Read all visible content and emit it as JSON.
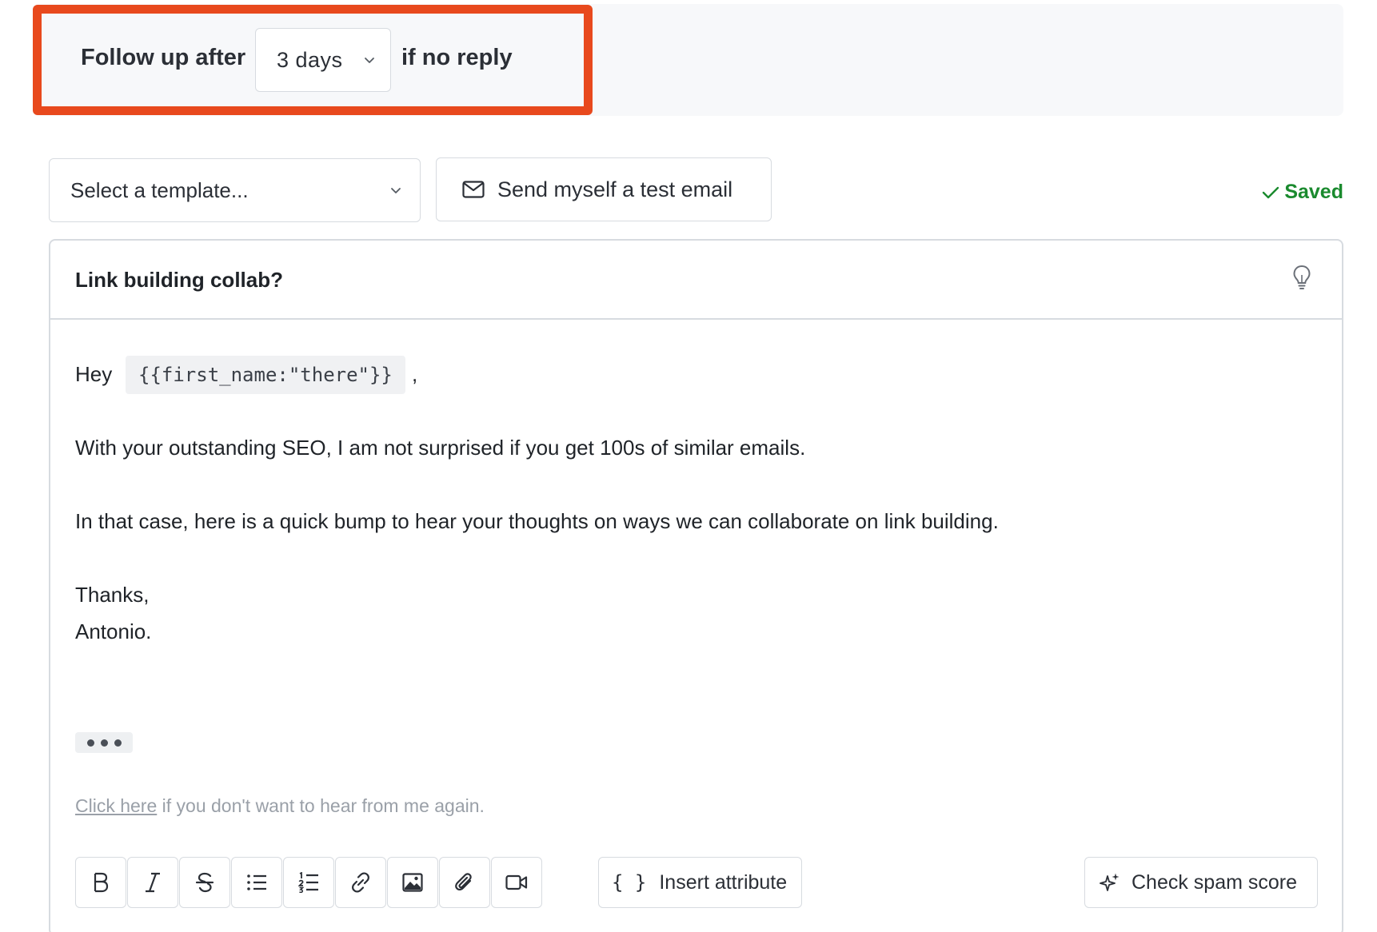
{
  "followup": {
    "prefix": "Follow up after",
    "delay_value": "3 days",
    "suffix": "if no reply"
  },
  "template_select": {
    "placeholder": "Select a template..."
  },
  "test_email_label": "Send myself a test email",
  "save_status": "Saved",
  "email": {
    "subject": "Link building collab?",
    "greeting": "Hey",
    "variable": "{{first_name:\"there\"}}",
    "greeting_punct": ",",
    "paragraphs": [
      "With your outstanding SEO, I am not surprised if you get 100s of similar emails.",
      "In that case, here is a quick bump to hear your thoughts on ways we can collaborate on link building."
    ],
    "signoff": "Thanks,",
    "signature": "Antonio.",
    "unsubscribe_link": "Click here",
    "unsubscribe_text": " if you don't want to hear from me again."
  },
  "toolbar": {
    "insert_attribute_label": "Insert attribute",
    "check_spam_label": "Check spam score",
    "tools": [
      "bold-icon",
      "italic-icon",
      "strikethrough-icon",
      "bullet-list-icon",
      "numbered-list-icon",
      "link-icon",
      "image-icon",
      "attachment-icon",
      "video-icon"
    ]
  },
  "colors": {
    "highlight": "#e8491d",
    "saved": "#1a8a2e",
    "border": "#d7dbe0"
  }
}
